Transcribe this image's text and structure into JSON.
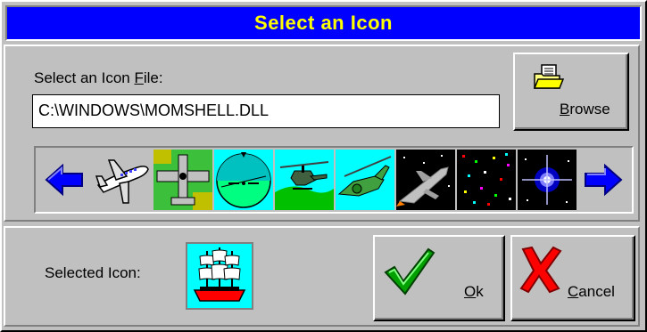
{
  "title": "Select an Icon",
  "file_section": {
    "label_prefix": "Select an Icon ",
    "label_accel": "F",
    "label_suffix": "ile:",
    "path_value": "C:\\WINDOWS\\MOMSHELL.DLL"
  },
  "browse_button": {
    "accel": "B",
    "rest": "rowse"
  },
  "icon_strip": {
    "icons": [
      "airplane-icon",
      "biplane-icon",
      "attitude-indicator-icon",
      "helicopter-icon",
      "gunship-icon",
      "jet-fighter-icon",
      "starfield-icon",
      "star-burst-icon"
    ]
  },
  "selected": {
    "label": "Selected Icon:",
    "icon": "sailing-ship-icon"
  },
  "ok_button": {
    "accel": "O",
    "rest": "k"
  },
  "cancel_button": {
    "accel": "C",
    "rest": "ancel"
  },
  "colors": {
    "title_bg": "#0000ff",
    "title_text": "#ffff00",
    "face": "#c0c0c0"
  }
}
